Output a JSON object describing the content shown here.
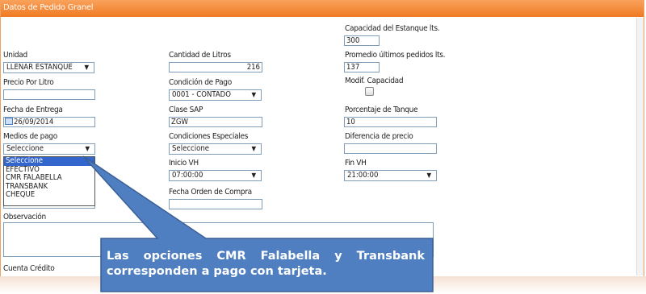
{
  "panel": {
    "title": "Datos de Pedido Granel"
  },
  "fields": {
    "unidad": {
      "label": "Unidad",
      "value": "LLENAR ESTANQUE"
    },
    "precio_por_litro": {
      "label": "Precio Por Litro",
      "value": ""
    },
    "fecha_entrega": {
      "label": "Fecha de Entrega",
      "value": "26/09/2014"
    },
    "medios_pago": {
      "label": "Medios de pago",
      "value": "Seleccione",
      "options": [
        "Seleccione",
        "EFECTIVO",
        "CMR FALABELLA",
        "TRANSBANK",
        "CHEQUE"
      ],
      "open": true
    },
    "cantidad_litros": {
      "label": "Cantidad de Litros",
      "value": "216"
    },
    "condicion_pago": {
      "label": "Condición de Pago",
      "value": "0001 - CONTADO"
    },
    "clase_sap": {
      "label": "Clase SAP",
      "value": "ZGW"
    },
    "condiciones_especiales": {
      "label": "Condiciones Especiales",
      "value": "Seleccione"
    },
    "inicio_vh": {
      "label": "Inicio VH",
      "value": "07:00:00"
    },
    "fecha_orden_compra": {
      "label": "Fecha Orden de Compra",
      "value": ""
    },
    "capacidad_estanque": {
      "label": "Capacidad del Estanque lts.",
      "value": "300"
    },
    "promedio_pedidos": {
      "label": "Promedio últimos pedidos lts.",
      "value": "137"
    },
    "modif_capacidad": {
      "label": "Modif. Capacidad",
      "checked": false
    },
    "porcentaje_tanque": {
      "label": "Porcentaje de Tanque",
      "value": "10"
    },
    "diferencia_precio": {
      "label": "Diferencia de precio",
      "value": ""
    },
    "fin_vh": {
      "label": "Fin VH",
      "value": "21:00:00"
    },
    "observacion": {
      "label": "Observación",
      "value": ""
    },
    "cuenta_credito": {
      "label": "Cuenta Crédito"
    }
  },
  "callout": {
    "text": "Las opciones CMR Falabella y Transbank corresponden a pago con tarjeta.",
    "color": "#4f7fc0"
  },
  "colors": {
    "header": "#f28a33",
    "dropdown_selected": "#3366cc"
  }
}
